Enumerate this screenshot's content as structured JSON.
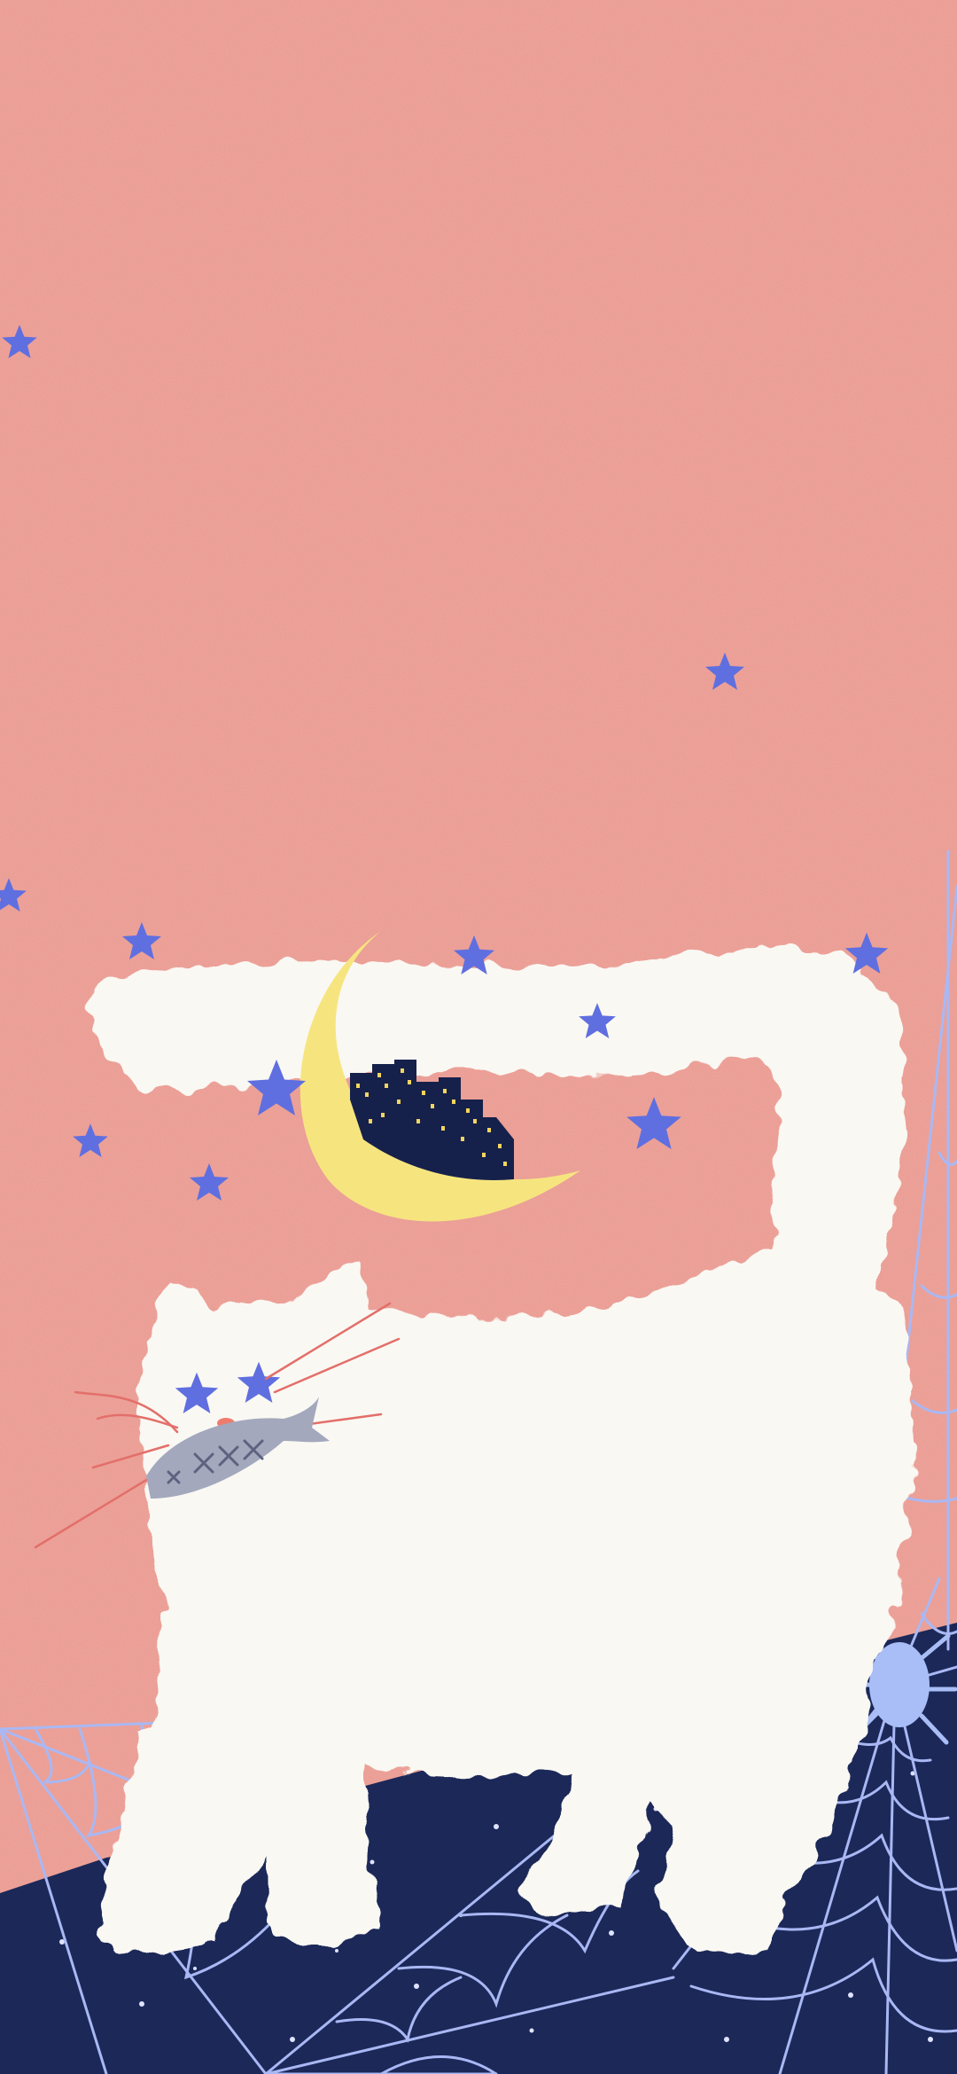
{
  "wallpaper": {
    "subject": "white-cat-with-fish",
    "colors": {
      "sky": "#f3a59c",
      "cat": "#faf8f3",
      "star": "#5f6fe0",
      "moon": "#f6e57f",
      "city": "#16214b",
      "window": "#f4d55e",
      "ground": "#1b2858",
      "web": "#a9b8f4",
      "fish": "#a3a8bd",
      "fish_mark": "#5d627f",
      "whisker": "#e36f6a",
      "nose": "#ef7b6c",
      "spider": "#a9bdf6"
    },
    "icons": [
      "star-icon",
      "crescent-moon-icon",
      "city-skyline-icon",
      "cat-illustration",
      "fish-icon",
      "spider-web-icon",
      "spider-icon"
    ]
  }
}
